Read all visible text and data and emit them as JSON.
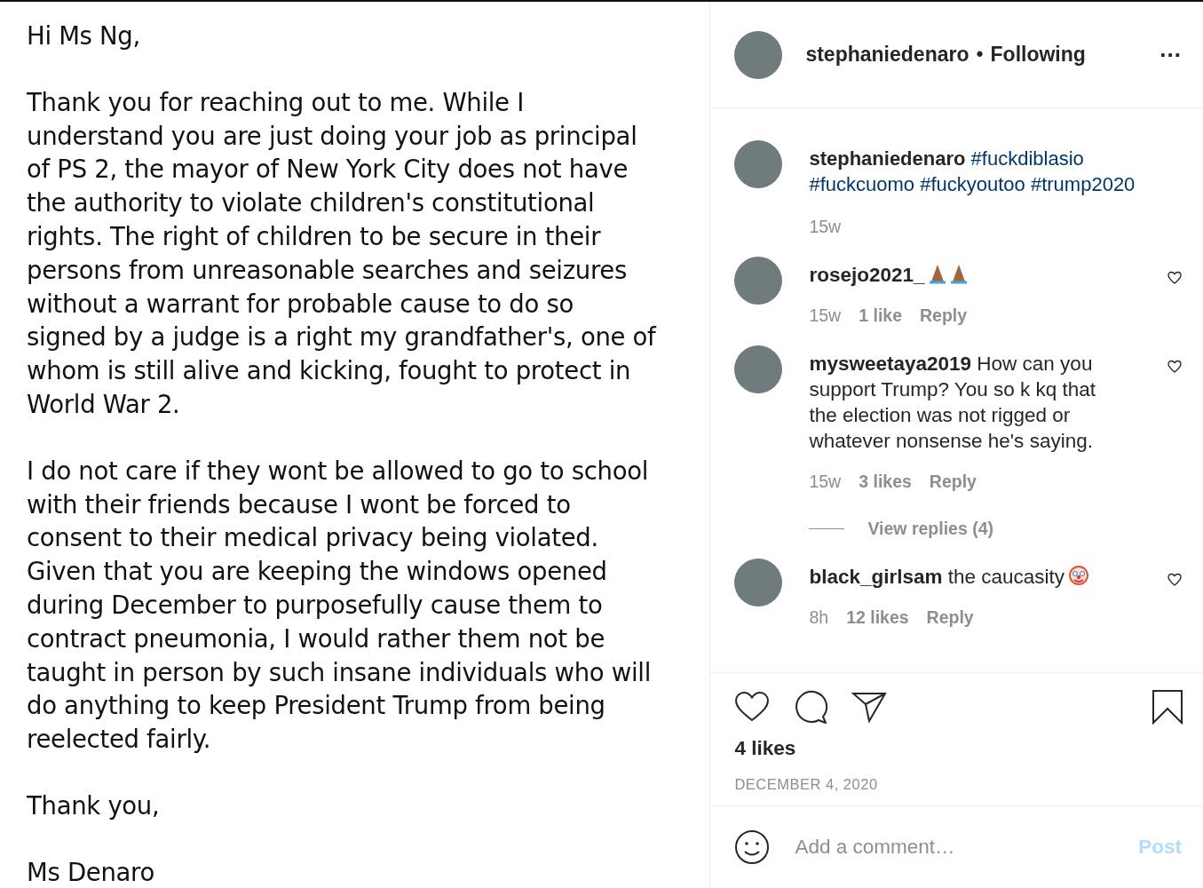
{
  "post_image": {
    "paragraphs": [
      [
        "Hi Ms Ng,"
      ],
      [
        "Thank you for reaching out to me. While I",
        "understand you are just doing your job as principal",
        "of PS 2, the mayor of New York City does not have",
        "the authority to violate children's constitutional",
        "rights. The right of children to be secure in their",
        "persons from unreasonable searches and seizures",
        "without a warrant for probable cause to do so",
        "signed by a judge is a right my grandfather's, one of",
        "whom is still alive and kicking, fought to protect in",
        "World War 2."
      ],
      [
        "I do not care if they wont be allowed to go to school",
        "with their friends because I wont be forced to",
        "consent to their medical privacy being violated.",
        "Given that you are keeping the windows opened",
        "during December to purposefully cause them to",
        "contract pneumonia, I would rather them not be",
        "taught in person by such insane individuals who will",
        "do anything to keep President Trump from being",
        "reelected fairly."
      ],
      [
        "Thank you,"
      ],
      [
        "Ms Denaro"
      ]
    ]
  },
  "header": {
    "username": "stephaniedenaro",
    "separator": "•",
    "follow": "Following",
    "more": "..."
  },
  "comments": [
    {
      "kind": "caption",
      "username": "stephaniedenaro",
      "tags": [
        "#fuckdiblasio",
        "#fuckcuomo",
        "#fuckyoutoo",
        "#trump2020"
      ],
      "time": "15w"
    },
    {
      "kind": "comment",
      "username": "rosejo2021_",
      "emoji": [
        {
          "kind": "pray"
        },
        {
          "kind": "pray"
        }
      ],
      "time": "15w",
      "likes": "1 like",
      "reply": "Reply"
    },
    {
      "kind": "comment",
      "username": "mysweetaya2019",
      "text": "How can you support Trump? You so k kq that the election was not rigged or whatever nonsense he's saying.",
      "time": "15w",
      "likes": "3 likes",
      "reply": "Reply",
      "view_replies": "View replies (4)"
    },
    {
      "kind": "comment",
      "username": "black_girlsam",
      "text": "the caucasity",
      "emoji": [
        {
          "kind": "clown"
        }
      ],
      "time": "8h",
      "likes": "12 likes",
      "reply": "Reply"
    }
  ],
  "likes": "4 likes",
  "date": "DECEMBER 4, 2020",
  "comment_box": {
    "placeholder": "Add a comment…",
    "post": "Post"
  }
}
